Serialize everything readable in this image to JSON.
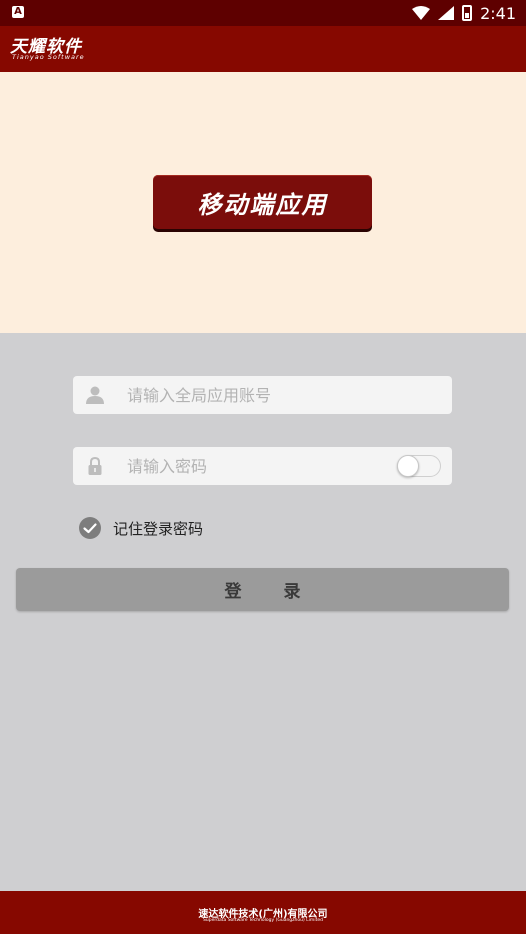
{
  "status_bar": {
    "left_icon": "A",
    "time": "2:41",
    "icons": [
      "wifi-icon",
      "signal-icon",
      "battery-icon"
    ]
  },
  "header": {
    "title": "天耀软件",
    "subtitle": "Tianyao Software"
  },
  "hero": {
    "badge_text": "移动端应用"
  },
  "form": {
    "account_placeholder": "请输入全局应用账号",
    "password_placeholder": "请输入密码",
    "remember_label": "记住登录密码",
    "remember_checked": true,
    "show_password": false,
    "login_label": "登 录"
  },
  "footer": {
    "company": "速达软件技术(广州)有限公司",
    "company_en": "Superdata Software Technology (Guangzhou) Limited"
  },
  "colors": {
    "header": "#860800",
    "hero_bg": "#fdeedd",
    "page_bg": "#cfcfd1",
    "button": "#9b9b9b"
  }
}
